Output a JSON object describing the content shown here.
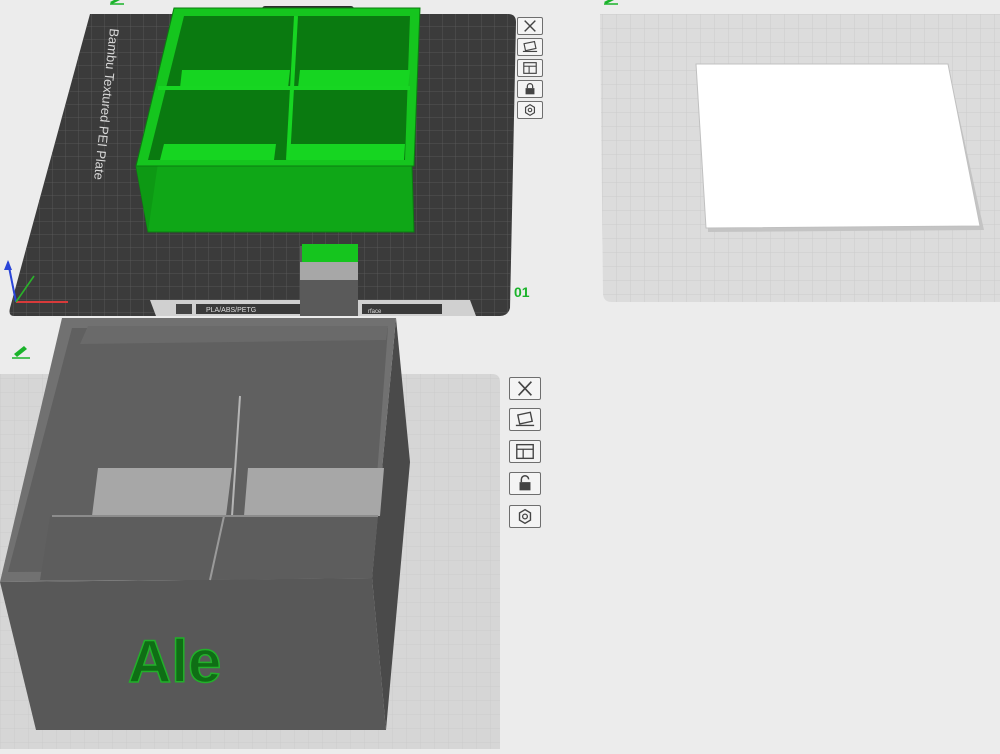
{
  "plates": [
    {
      "number": "01",
      "plate_type": "Bambu Textured PEI Plate",
      "filament_label": "PLA/ABS/PETG",
      "footer_right_label": "rface"
    }
  ],
  "model": {
    "label": "Ale"
  },
  "colors": {
    "accent_green": "#1ab32a",
    "selected_model": "#12c21e",
    "model_gray": "#5a5a5a",
    "plate_dark": "#3b3b3b",
    "plate_light": "#d8d8d8",
    "background": "#ececec"
  },
  "toolbar_icons": [
    "close-icon",
    "auto-arrange-icon",
    "layout-icon",
    "lock-icon",
    "settings-hex-icon"
  ]
}
